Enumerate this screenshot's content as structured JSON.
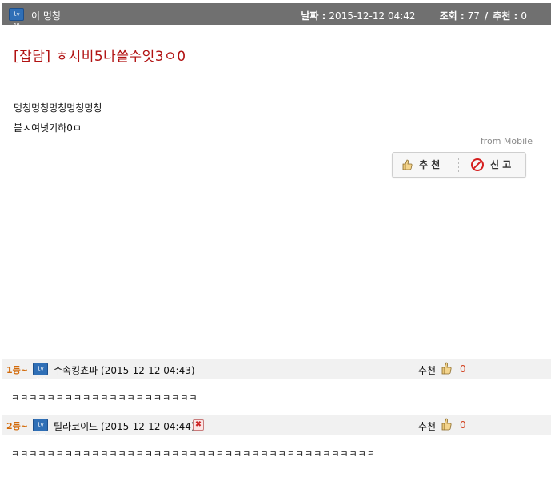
{
  "post": {
    "author_level": "lv 18",
    "author": "이 멍청",
    "date_label": "날짜 :",
    "date": "2015-12-12 04:42",
    "views_label": "조회 :",
    "views": "77",
    "recommend_label": "추천 :",
    "recommends": "0",
    "title": "[잡담] ㅎ시비5나쓸수잇3ㅇ0",
    "body": [
      "멍청멍청멍청멍청멍청",
      "붙ㅅ여넛기하0ㅁ"
    ],
    "from": "from Mobile"
  },
  "buttons": {
    "recommend": "추 천",
    "report": "신 고"
  },
  "colors": {
    "header_bg": "#707070",
    "title": "#b11212",
    "rank": "#d26a0a",
    "count": "#d2401e"
  },
  "comments": [
    {
      "rank": "1등~",
      "level": "lv 114",
      "name": "수속킹쵸파",
      "date": "(2015-12-12 04:43)",
      "has_delete": false,
      "rec_label": "추천",
      "rec_count": "0",
      "text": "ㅋㅋㅋㅋㅋㅋㅋㅋㅋㅋㅋㅋㅋㅋㅋㅋㅋㅋㅋㅋㅋ"
    },
    {
      "rank": "2등~",
      "level": "lv 127",
      "name": "틸라코이드",
      "date": "(2015-12-12 04:44)",
      "has_delete": true,
      "delete_glyph": "✖",
      "rec_label": "추천",
      "rec_count": "0",
      "text": "ㅋㅋㅋㅋㅋㅋㅋㅋㅋㅋㅋㅋㅋㅋㅋㅋㅋㅋㅋㅋㅋㅋㅋㅋㅋㅋㅋㅋㅋㅋㅋㅋㅋㅋㅋㅋㅋㅋㅋㅋㅋ"
    }
  ]
}
